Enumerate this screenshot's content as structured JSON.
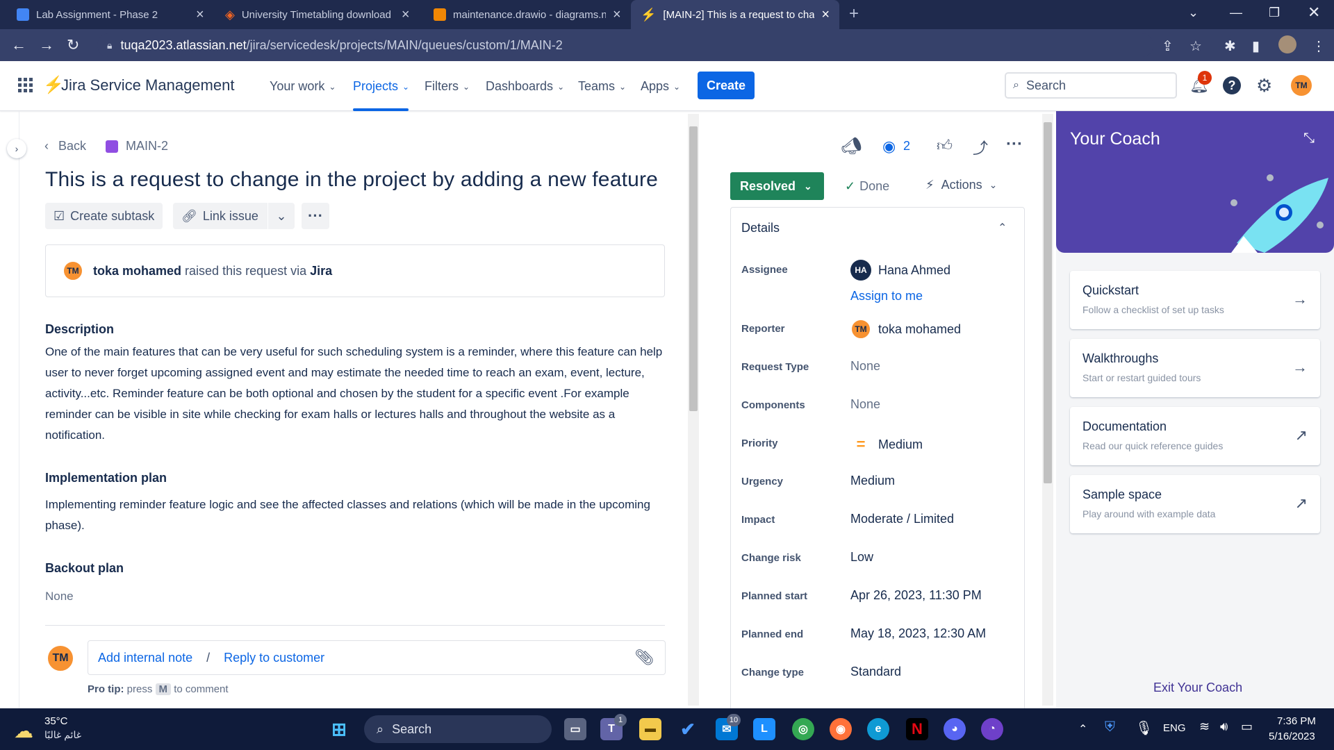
{
  "browser": {
    "tabs": [
      {
        "title": "Lab Assignment - Phase 2",
        "icon": "docs-icon",
        "active": false
      },
      {
        "title": "University Timetabling download",
        "icon": "gitlab-diamond-icon",
        "active": false
      },
      {
        "title": "maintenance.drawio - diagrams.n",
        "icon": "drawio-icon",
        "active": false
      },
      {
        "title": "[MAIN-2] This is a request to cha",
        "icon": "jira-icon",
        "active": true
      }
    ],
    "url_host": "tuqa2023.atlassian.net",
    "url_path": "/jira/servicedesk/projects/MAIN/queues/custom/1/MAIN-2"
  },
  "jira_nav": {
    "product": "Jira Service Management",
    "items": [
      "Your work",
      "Projects",
      "Filters",
      "Dashboards",
      "Teams",
      "Apps"
    ],
    "active_item": "Projects",
    "create_label": "Create",
    "search_placeholder": "Search",
    "notification_count": "1",
    "user_initials": "TM"
  },
  "issue": {
    "back_label": "Back",
    "key": "MAIN-2",
    "title": "This is a request to change in the project by adding a new feature",
    "toolbar": {
      "create_subtask": "Create subtask",
      "link_issue": "Link issue"
    },
    "raised": {
      "name": "toka mohamed",
      "text": "raised this request via",
      "via": "Jira",
      "initials": "TM"
    },
    "description_heading": "Description",
    "description": "One of the main features that can be very useful for such scheduling system is a reminder, where this feature can help user to never forget upcoming assigned event and may estimate the needed time to reach an exam, event, lecture, activity...etc. Reminder feature can be both optional and chosen by the student for a specific event .For example reminder can be visible in site while checking for exam halls or lectures halls and throughout the website as a notification.",
    "impl_heading": "Implementation plan",
    "impl_body": "Implementing reminder feature logic and see the affected classes and relations (which will be made in the upcoming phase).",
    "backout_heading": "Backout plan",
    "backout_body": "None",
    "comment": {
      "add_note": "Add internal note",
      "separator": "/",
      "reply": "Reply to customer",
      "initials": "TM"
    },
    "protip": {
      "label": "Pro tip:",
      "text1": "press",
      "key": "M",
      "text2": "to comment"
    }
  },
  "side": {
    "watchers": "2",
    "status": "Resolved",
    "resolution": "Done",
    "actions_label": "Actions",
    "details_heading": "Details",
    "fields": [
      {
        "label": "Assignee",
        "value": "Hana Ahmed",
        "avatar": "HA"
      },
      {
        "label": "Reporter",
        "value": "toka mohamed",
        "avatar": "TM"
      },
      {
        "label": "Request Type",
        "value": "None"
      },
      {
        "label": "Components",
        "value": "None"
      },
      {
        "label": "Priority",
        "value": "Medium"
      },
      {
        "label": "Urgency",
        "value": "Medium"
      },
      {
        "label": "Impact",
        "value": "Moderate / Limited"
      },
      {
        "label": "Change risk",
        "value": "Low"
      },
      {
        "label": "Planned start",
        "value": "Apr 26, 2023, 11:30 PM"
      },
      {
        "label": "Planned end",
        "value": "May 18, 2023, 12:30 AM"
      },
      {
        "label": "Change type",
        "value": "Standard"
      }
    ],
    "assign_to_me": "Assign to me",
    "colors": {
      "resolved": "#1f845a",
      "priority_medium": "#ff991f"
    }
  },
  "coach": {
    "title": "Your Coach",
    "cards": [
      {
        "title": "Quickstart",
        "subtitle": "Follow a checklist of set up tasks",
        "icon": "arrow-right-icon"
      },
      {
        "title": "Walkthroughs",
        "subtitle": "Start or restart guided tours",
        "icon": "arrow-right-icon"
      },
      {
        "title": "Documentation",
        "subtitle": "Read our quick reference guides",
        "icon": "external-link-icon"
      },
      {
        "title": "Sample space",
        "subtitle": "Play around with example data",
        "icon": "external-link-icon"
      }
    ],
    "exit_label": "Exit Your Coach"
  },
  "taskbar": {
    "weather_temp": "35°C",
    "weather_text": "غائم غالبًا",
    "search_label": "Search",
    "lang": "ENG",
    "time": "7:36 PM",
    "date": "5/16/2023",
    "badges": {
      "teams": "1",
      "mail": "10"
    }
  }
}
